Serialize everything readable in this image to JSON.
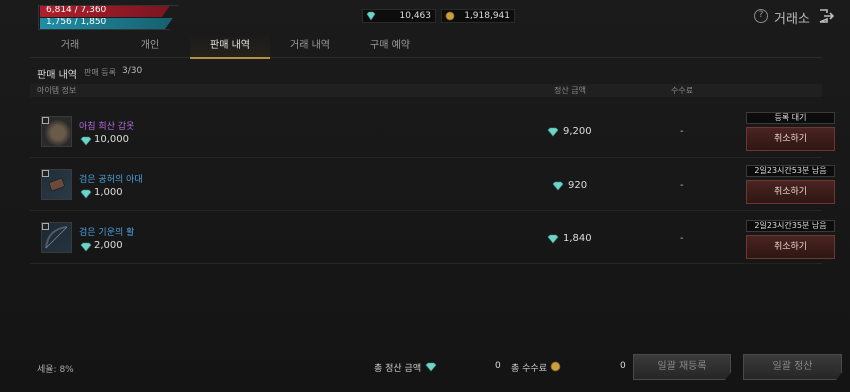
{
  "status": {
    "hp_text": "6,814 / 7,360",
    "hp_fraction": 0.926,
    "mp_text": "1,756 / 1,850",
    "mp_fraction": 0.949
  },
  "currency": {
    "gems": "10,463",
    "gold": "1,918,941"
  },
  "header": {
    "title": "거래소",
    "help_icon": "question-circle-icon",
    "exit_icon": "exit-door-icon"
  },
  "tabs": [
    {
      "label": "거래",
      "active": false
    },
    {
      "label": "개인",
      "active": false
    },
    {
      "label": "판매 내역",
      "active": true
    },
    {
      "label": "거래 내역",
      "active": false
    },
    {
      "label": "구매 예약",
      "active": false
    }
  ],
  "section": {
    "title": "판매 내역",
    "subtitle": "판매 등록",
    "count": "3/30"
  },
  "columns": {
    "item": "아이템 정보",
    "settle": "정산 금액",
    "fee": "수수료"
  },
  "rows": [
    {
      "name": "아침 희산 갑옷",
      "name_color": "#b36be0",
      "price": "10,000",
      "settle": "9,200",
      "fee": "-",
      "status": "등록 대기",
      "action": "취소하기"
    },
    {
      "name": "검은 공허의 아대",
      "name_color": "#4aa3e0",
      "price": "1,000",
      "settle": "920",
      "fee": "-",
      "status": "2일23시간53분 남음",
      "action": "취소하기"
    },
    {
      "name": "검은 기운의 활",
      "name_color": "#4aa3e0",
      "price": "2,000",
      "settle": "1,840",
      "fee": "-",
      "status": "2일23시간35분 남음",
      "action": "취소하기"
    }
  ],
  "footer": {
    "tax": "세율: 8%",
    "total_settle_label": "총 정산 금액",
    "total_settle_value": "0",
    "total_fee_label": "총 수수료",
    "total_fee_value": "0",
    "bulk_relist": "일괄 재등록",
    "bulk_settle": "일괄 정산"
  }
}
